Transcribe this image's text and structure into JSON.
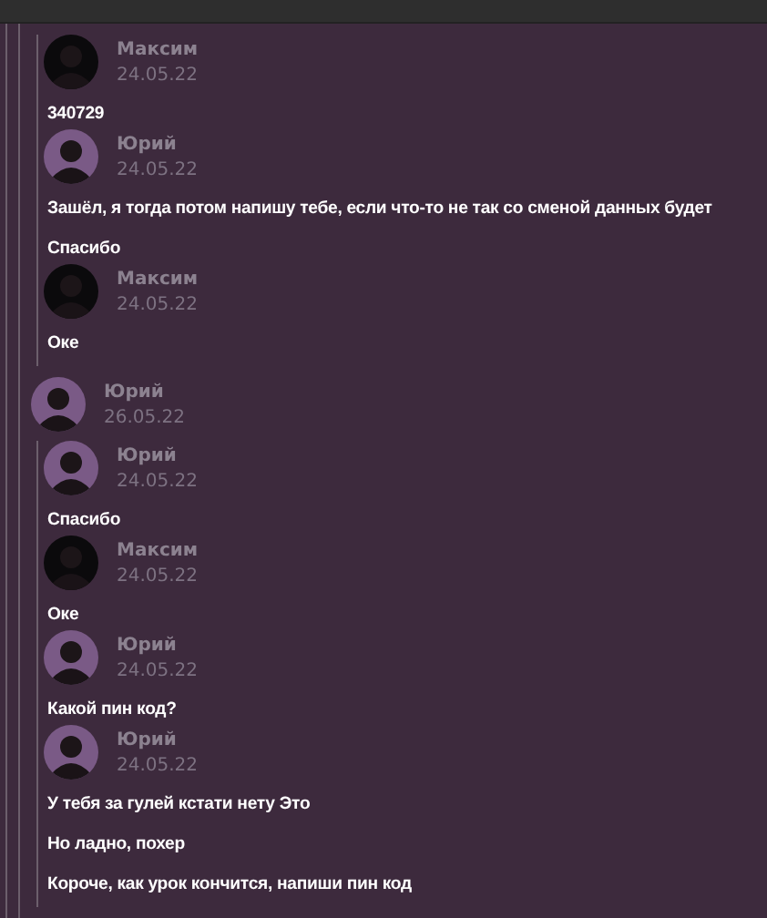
{
  "forward": {
    "groups": [
      {
        "kind": "nested",
        "messages": [
          {
            "author": "Максим",
            "date": "24.05.22",
            "color": "#0b0a0c",
            "texts": [
              "340729"
            ]
          },
          {
            "author": "Юрий",
            "date": "24.05.22",
            "color": "#7a5a86",
            "texts": [
              "Зашёл, я тогда потом напишу тебе, если что-то не так со сменой данных будет",
              "Спасибо"
            ]
          },
          {
            "author": "Максим",
            "date": "24.05.22",
            "color": "#0b0a0c",
            "texts": [
              "Оке"
            ]
          }
        ]
      },
      {
        "kind": "header",
        "author": "Юрий",
        "date": "26.05.22",
        "color": "#7a5a86"
      },
      {
        "kind": "nested",
        "messages": [
          {
            "author": "Юрий",
            "date": "24.05.22",
            "color": "#7a5a86",
            "texts": [
              "Спасибо"
            ]
          },
          {
            "author": "Максим",
            "date": "24.05.22",
            "color": "#0b0a0c",
            "texts": [
              "Оке"
            ]
          },
          {
            "author": "Юрий",
            "date": "24.05.22",
            "color": "#7a5a86",
            "texts": [
              "Какой пин код?"
            ]
          },
          {
            "author": "Юрий",
            "date": "24.05.22",
            "color": "#7a5a86",
            "texts": [
              "У тебя за гулей кстати нету Это",
              "Но ладно, похер",
              "Короче, как урок кончится, напиши пин код"
            ]
          }
        ]
      }
    ]
  }
}
